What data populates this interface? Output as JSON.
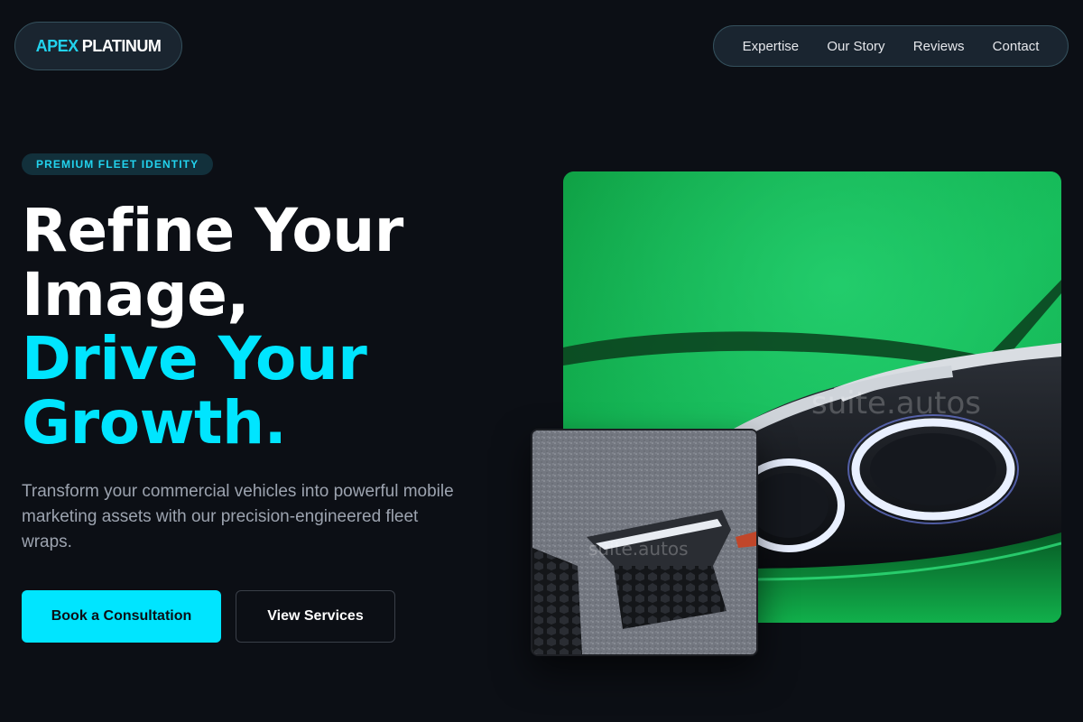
{
  "brand": {
    "accent": "APEX",
    "rest": "PLATINUM"
  },
  "nav": {
    "items": [
      "Expertise",
      "Our Story",
      "Reviews",
      "Contact"
    ]
  },
  "hero": {
    "eyebrow": "PREMIUM FLEET IDENTITY",
    "headline_line1": "Refine Your",
    "headline_line2": "Image,",
    "headline_line3": "Drive Your",
    "headline_line4": "Growth.",
    "lede": "Transform your commercial vehicles into powerful mobile marketing assets with our precision-engineered fleet wraps.",
    "primary_cta": "Book a Consultation",
    "secondary_cta": "View Services"
  },
  "images": {
    "main_watermark": "suite.autos",
    "small_watermark": "suite.autos"
  },
  "colors": {
    "background": "#0c0f15",
    "accent": "#00e5ff",
    "pill_bg": "#1a2530",
    "muted_text": "#9ca3af"
  }
}
